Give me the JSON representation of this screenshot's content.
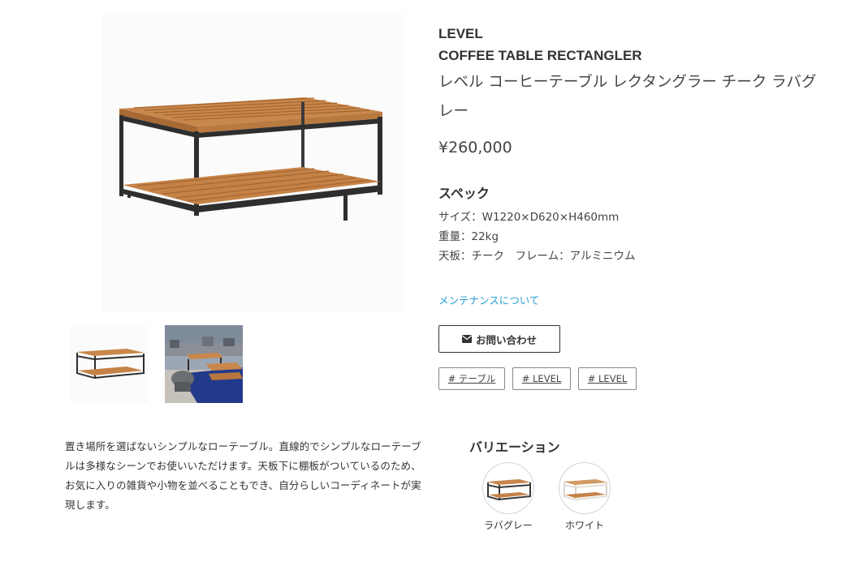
{
  "product": {
    "brand": "LEVEL",
    "name_en": "COFFEE TABLE RECTANGLER",
    "name_ja": "レベル コーヒーテーブル レクタングラー チーク ラバグレー",
    "price": "¥260,000"
  },
  "spec": {
    "heading": "スペック",
    "size": "サイズ：W1220×D620×H460mm",
    "weight": "重量：22kg",
    "material": "天板：チーク　フレーム：アルミニウム"
  },
  "links": {
    "maintenance": "メンテナンスについて"
  },
  "buttons": {
    "inquiry": "お問い合わせ",
    "inquiry_icon": "envelope-icon"
  },
  "tags": [
    "# テーブル",
    "# LEVEL",
    "# LEVEL"
  ],
  "description": "置き場所を選ばないシンプルなローテーブル。直線的でシンプルなローテーブルは多様なシーンでお使いいただけます。天板下に棚板がついているのため、お気に入りの雑貨や小物を並べることもでき、自分らしいコーディネートが実現します。",
  "variations": {
    "heading": "バリエーション",
    "items": [
      {
        "label": "ラバグレー",
        "frame_color": "#3a3a3a"
      },
      {
        "label": "ホワイト",
        "frame_color": "#e8e4de"
      }
    ]
  },
  "colors": {
    "teak": "#b8763e",
    "teak_light": "#d09a62",
    "frame_dark": "#2e2e2e",
    "link": "#2a9fd6",
    "rug_blue": "#223a8a"
  }
}
